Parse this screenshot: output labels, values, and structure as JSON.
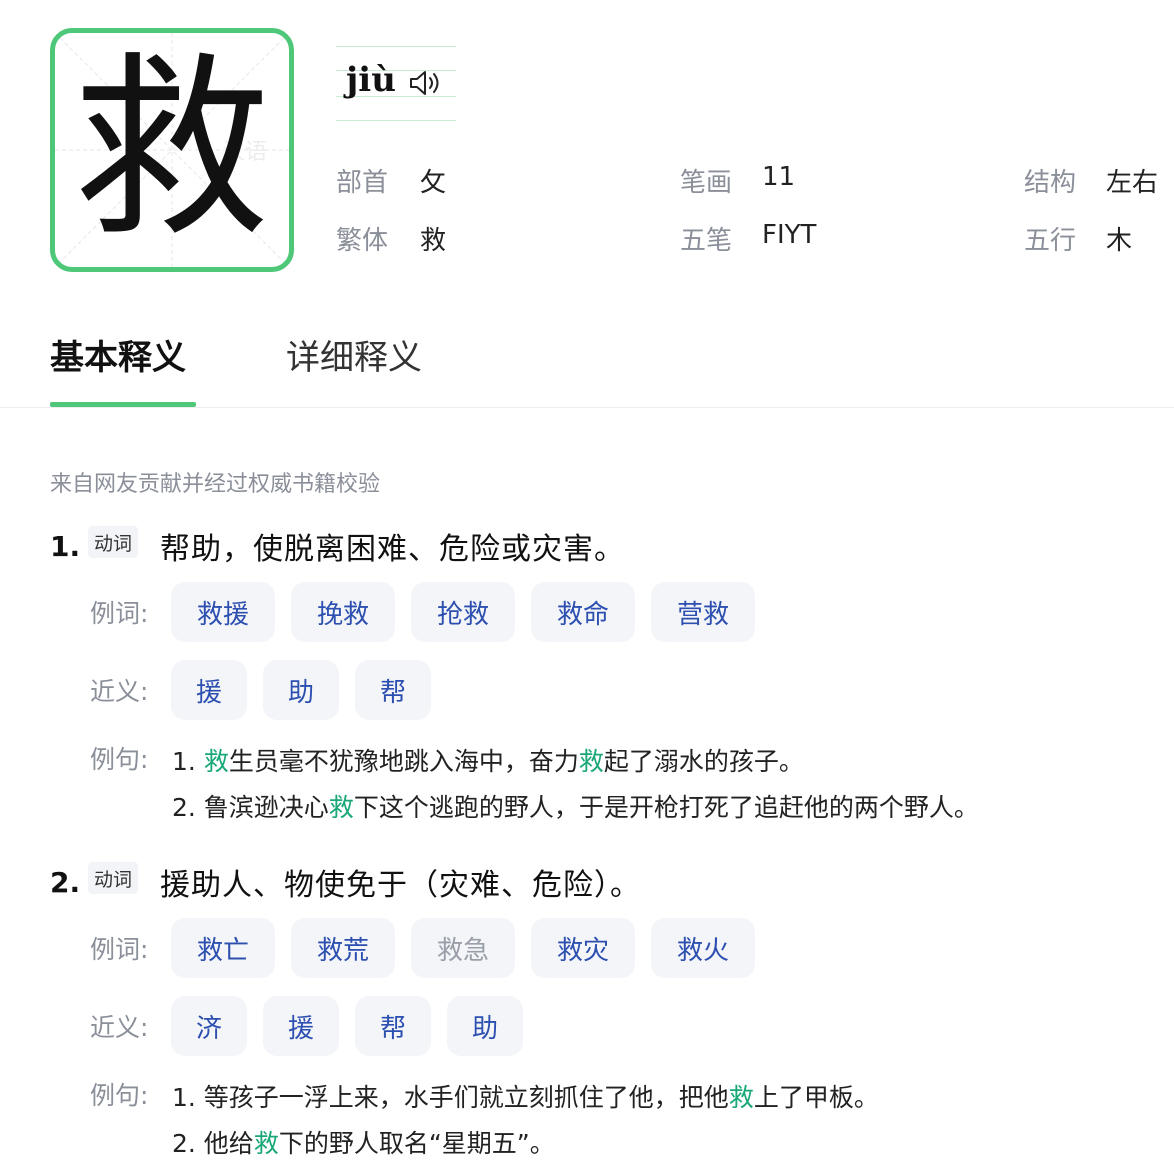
{
  "character": {
    "glyph": "救",
    "watermark": "汉语",
    "pinyin": "jiù"
  },
  "info": [
    {
      "label": "部首",
      "value": "攵"
    },
    {
      "label": "笔画",
      "value": "11"
    },
    {
      "label": "结构",
      "value": "左右"
    },
    {
      "label": "繁体",
      "value": "救"
    },
    {
      "label": "五笔",
      "value": "FIYT"
    },
    {
      "label": "五行",
      "value": "木"
    }
  ],
  "tabs": [
    {
      "label": "基本释义",
      "active": true
    },
    {
      "label": "详细释义",
      "active": false
    }
  ],
  "source_note": "来自网友贡献并经过权威书籍校验",
  "row_labels": {
    "words": "例词:",
    "synonyms": "近义:",
    "sentences": "例句:"
  },
  "definitions": [
    {
      "number": "1.",
      "pos": "动词",
      "text": "帮助，使脱离困难、危险或灾害。",
      "words": [
        {
          "text": "救援",
          "muted": false
        },
        {
          "text": "挽救",
          "muted": false
        },
        {
          "text": "抢救",
          "muted": false
        },
        {
          "text": "救命",
          "muted": false
        },
        {
          "text": "营救",
          "muted": false
        }
      ],
      "synonyms": [
        "援",
        "助",
        "帮"
      ],
      "sentences": [
        [
          "1. ",
          {
            "hl": "救"
          },
          "生员毫不犹豫地跳入海中，奋力",
          {
            "hl": "救"
          },
          "起了溺水的孩子。"
        ],
        [
          "2. 鲁滨逊决心",
          {
            "hl": "救"
          },
          "下这个逃跑的野人，于是开枪打死了追赶他的两个野人。"
        ]
      ]
    },
    {
      "number": "2.",
      "pos": "动词",
      "text": "援助人、物使免于（灾难、危险）。",
      "words": [
        {
          "text": "救亡",
          "muted": false
        },
        {
          "text": "救荒",
          "muted": false
        },
        {
          "text": "救急",
          "muted": true
        },
        {
          "text": "救灾",
          "muted": false
        },
        {
          "text": "救火",
          "muted": false
        }
      ],
      "synonyms": [
        "济",
        "援",
        "帮",
        "助"
      ],
      "sentences": [
        [
          "1. 等孩子一浮上来，水手们就立刻抓住了他，把他",
          {
            "hl": "救"
          },
          "上了甲板。"
        ],
        [
          "2. 他给",
          {
            "hl": "救"
          },
          "下的野人取名“星期五”。"
        ]
      ]
    }
  ],
  "colors": {
    "accent": "#4fc779",
    "highlight": "#1aa87a",
    "chip_text": "#2c4fb0",
    "label_gray": "#8a8f99"
  }
}
